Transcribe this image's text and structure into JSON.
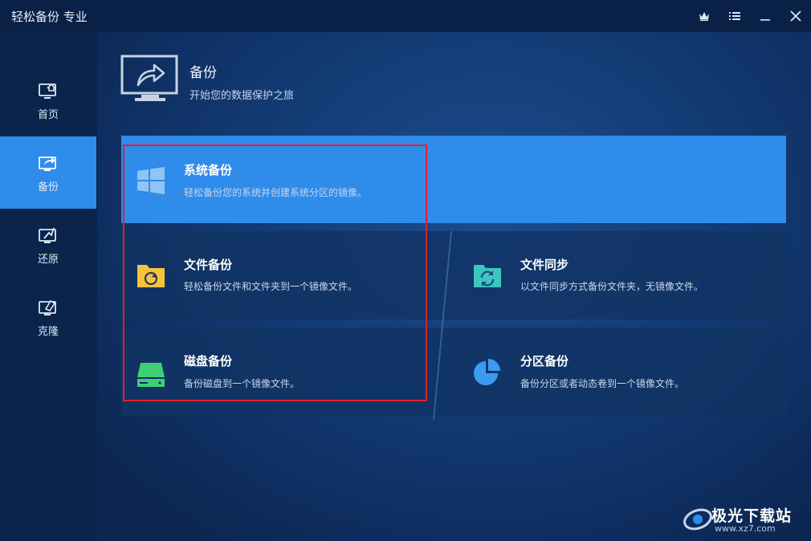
{
  "window": {
    "title": "轻松备份 专业",
    "controls": [
      "crown-icon",
      "menu-icon",
      "minimize-icon",
      "close-icon"
    ]
  },
  "sidebar": {
    "items": [
      {
        "label": "首页",
        "icon": "home-monitor-icon",
        "active": false
      },
      {
        "label": "备份",
        "icon": "backup-monitor-icon",
        "active": true
      },
      {
        "label": "还原",
        "icon": "restore-monitor-icon",
        "active": false
      },
      {
        "label": "克隆",
        "icon": "clone-monitor-icon",
        "active": false
      }
    ]
  },
  "header": {
    "title": "备份",
    "subtitle": "开始您的数据保护之旅"
  },
  "cards": {
    "system_backup": {
      "title": "系统备份",
      "desc": "轻松备份您的系统并创建系统分区的镜像。",
      "icon": "windows-icon"
    },
    "file_backup": {
      "title": "文件备份",
      "desc": "轻松备份文件和文件夹到一个镜像文件。",
      "icon": "folder-backup-icon"
    },
    "file_sync": {
      "title": "文件同步",
      "desc": "以文件同步方式备份文件夹，无镜像文件。",
      "icon": "folder-sync-icon"
    },
    "disk_backup": {
      "title": "磁盘备份",
      "desc": "备份磁盘到一个镜像文件。",
      "icon": "disk-icon"
    },
    "partition_backup": {
      "title": "分区备份",
      "desc": "备份分区或者动态卷到一个镜像文件。",
      "icon": "pie-partition-icon"
    }
  },
  "colors": {
    "accent": "#2f8ceb",
    "highlight_box": "#e2202a",
    "folder_yellow": "#f6c33d",
    "sync_teal": "#3cc6c0",
    "disk_green": "#3fcf73",
    "pie_blue": "#3a9cf0"
  },
  "watermark": {
    "text": "极光下载站",
    "url": "www.xz7.com"
  }
}
